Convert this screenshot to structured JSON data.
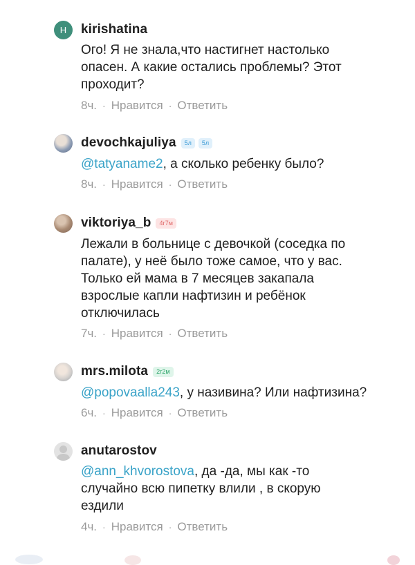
{
  "comments": [
    {
      "username": "kirishatina",
      "avatar_letter": "Н",
      "badges": [],
      "lines": [
        "Ого! Я не знала,что настигнет настолько",
        "опасен. А какие остались проблемы? Этот",
        "проходит?"
      ],
      "mention": "",
      "time": "8ч.",
      "like": "Нравится",
      "reply": "Ответить"
    },
    {
      "username": "devochkajuliya",
      "badges": [
        "5л",
        "5л"
      ],
      "mention": "@tatyaname2",
      "after_mention": ", а сколько ребенку было?",
      "time": "8ч.",
      "like": "Нравится",
      "reply": "Ответить"
    },
    {
      "username": "viktoriya_b",
      "badges": [
        "4г7м"
      ],
      "lines": [
        "Лежали в больнице с девочкой (соседка по",
        "палате), у неё было тоже самое, что у вас.",
        "Только ей мама в 7 месяцев закапала",
        "взрослые капли нафтизин и ребёнок",
        "отключилась"
      ],
      "time": "7ч.",
      "like": "Нравится",
      "reply": "Ответить"
    },
    {
      "username": "mrs.milota",
      "badges": [
        "2г2м"
      ],
      "mention": "@popovaalla243",
      "after_mention": ", у називина? Или нафтизина?",
      "time": "6ч.",
      "like": "Нравится",
      "reply": "Ответить"
    },
    {
      "username": "anutarostov",
      "badges": [],
      "mention": "@ann_khvorostova",
      "after_mention": ", да -да, мы как -то",
      "lines": [
        "случайно всю пипетку влили , в скорую",
        "ездили"
      ],
      "time": "4ч.",
      "like": "Нравится",
      "reply": "Ответить"
    }
  ],
  "dot": "·",
  "colors": {
    "mention": "#3aa3c8",
    "meta": "#9a9a9a",
    "avatar_letter_bg": "#3f8f7b"
  }
}
